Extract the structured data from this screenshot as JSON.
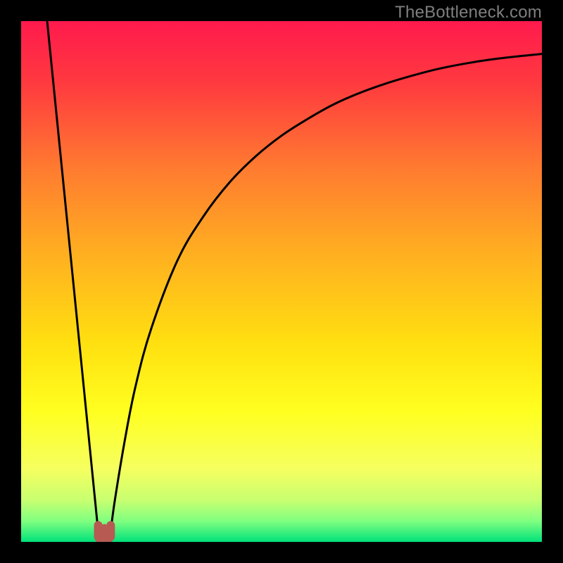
{
  "watermark": "TheBottleneck.com",
  "chart_data": {
    "type": "line",
    "title": "",
    "xlabel": "",
    "ylabel": "",
    "xlim": [
      0,
      100
    ],
    "ylim": [
      0,
      100
    ],
    "grid": false,
    "legend": false,
    "background_gradient": {
      "stops": [
        {
          "offset": 0.0,
          "color": "#ff1a4d"
        },
        {
          "offset": 0.12,
          "color": "#ff3a3f"
        },
        {
          "offset": 0.28,
          "color": "#ff7a30"
        },
        {
          "offset": 0.45,
          "color": "#ffb020"
        },
        {
          "offset": 0.62,
          "color": "#ffe010"
        },
        {
          "offset": 0.75,
          "color": "#ffff20"
        },
        {
          "offset": 0.86,
          "color": "#f5ff60"
        },
        {
          "offset": 0.92,
          "color": "#c8ff70"
        },
        {
          "offset": 0.96,
          "color": "#80ff80"
        },
        {
          "offset": 1.0,
          "color": "#00e27a"
        }
      ]
    },
    "series": [
      {
        "name": "left-branch",
        "x": [
          5.0,
          6.0,
          7.0,
          8.0,
          9.0,
          10.0,
          11.0,
          12.0,
          13.0,
          14.0,
          14.8
        ],
        "y": [
          100.0,
          90.0,
          80.0,
          70.0,
          60.0,
          50.0,
          40.0,
          30.0,
          20.0,
          10.0,
          2.0
        ]
      },
      {
        "name": "right-branch",
        "x": [
          17.2,
          18.0,
          20.0,
          22.0,
          25.0,
          30.0,
          35.0,
          40.0,
          45.0,
          50.0,
          55.0,
          60.0,
          65.0,
          70.0,
          75.0,
          80.0,
          85.0,
          90.0,
          95.0,
          100.0
        ],
        "y": [
          2.0,
          8.0,
          20.0,
          30.0,
          41.0,
          54.0,
          62.5,
          69.0,
          74.0,
          78.0,
          81.2,
          84.0,
          86.2,
          88.0,
          89.5,
          90.8,
          91.8,
          92.6,
          93.2,
          93.7
        ]
      },
      {
        "name": "valley-marker",
        "shape": "u",
        "x": [
          14.8,
          14.8,
          15.4,
          16.0,
          16.0,
          16.6,
          17.2,
          17.2
        ],
        "y": [
          3.2,
          1.0,
          1.0,
          2.6,
          1.0,
          1.0,
          1.0,
          3.2
        ],
        "color": "#b65a52"
      }
    ]
  }
}
